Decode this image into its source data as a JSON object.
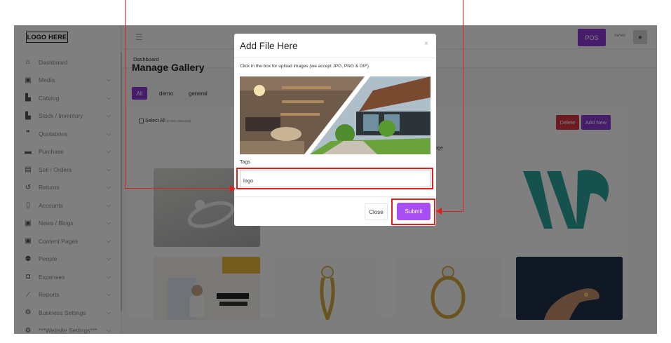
{
  "logo": "LOGO HERE",
  "sidebar": {
    "items": [
      {
        "label": "Dashboard",
        "icon": "home-icon",
        "glyph": "⌂",
        "chevron": false
      },
      {
        "label": "Media",
        "icon": "image-icon",
        "glyph": "▣",
        "chevron": true
      },
      {
        "label": "Catalog",
        "icon": "boxes-icon",
        "glyph": "▙",
        "chevron": true
      },
      {
        "label": "Stock / Inventory",
        "icon": "boxes-icon",
        "glyph": "▙",
        "chevron": true
      },
      {
        "label": "Quotations",
        "icon": "quote-icon",
        "glyph": "❞",
        "chevron": true
      },
      {
        "label": "Purchase",
        "icon": "card-icon",
        "glyph": "▬",
        "chevron": true
      },
      {
        "label": "Sell / Orders",
        "icon": "clipboard-icon",
        "glyph": "▤",
        "chevron": true
      },
      {
        "label": "Returns",
        "icon": "undo-icon",
        "glyph": "↺",
        "chevron": true
      },
      {
        "label": "Accounts",
        "icon": "file-icon",
        "glyph": "▯",
        "chevron": true
      },
      {
        "label": "News / Blogs",
        "icon": "image-icon",
        "glyph": "▣",
        "chevron": true
      },
      {
        "label": "Content Pages",
        "icon": "image-icon",
        "glyph": "▣",
        "chevron": true
      },
      {
        "label": "People",
        "icon": "people-icon",
        "glyph": "⚉",
        "chevron": true
      },
      {
        "label": "Expenses",
        "icon": "money-icon",
        "glyph": "◘",
        "chevron": true
      },
      {
        "label": "Reports",
        "icon": "chart-icon",
        "glyph": "⟋",
        "chevron": true
      },
      {
        "label": "Business Settings",
        "icon": "gears-icon",
        "glyph": "⚙",
        "chevron": true
      },
      {
        "label": "***Website Settings***",
        "icon": "gears-icon",
        "glyph": "⚙",
        "chevron": true
      }
    ]
  },
  "topbar": {
    "pos": "POS",
    "owner": "owner"
  },
  "breadcrumb": "Dashboard",
  "page": {
    "title": "Manage Gallery",
    "filters": [
      "All",
      "demo",
      "general"
    ],
    "select_all": "Select All",
    "selected_count": "(0 Item Selected)",
    "delete": "Delete",
    "add_new": "Add New",
    "broken_image_alt": "image"
  },
  "modal": {
    "title": "Add File Here",
    "close_x": "×",
    "hint": "Click in the box for upload images (we accept JPG, PNG & GIF).",
    "tags_label": "Tags",
    "tags_value": "logo",
    "close_btn": "Close",
    "submit_btn": "Submit"
  },
  "colors": {
    "accent": "#8e3ad6",
    "submit": "#a74ef4",
    "danger": "#dc3545",
    "annotation": "#e41e1e"
  }
}
